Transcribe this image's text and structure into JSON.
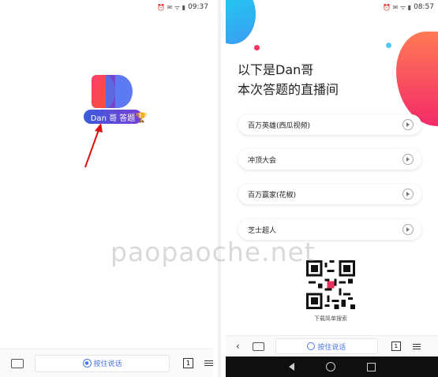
{
  "left": {
    "status_time": "09:37",
    "brand_label": "Dan 哥 答题",
    "bottom": {
      "talk_label": "按住说话",
      "tab_count": "1"
    }
  },
  "right": {
    "status_time": "08:57",
    "headline_line1": "以下是Dan哥",
    "headline_line2": "本次答题的直播间",
    "items": [
      {
        "label": "百万英雄(西瓜视频)"
      },
      {
        "label": "冲顶大会"
      },
      {
        "label": "百万赢家(花椒)"
      },
      {
        "label": "芝士超人"
      }
    ],
    "qr_caption": "下载简单搜索",
    "bottom": {
      "talk_label": "按住说话",
      "tab_count": "1"
    }
  },
  "watermark": "paopaoche.net",
  "colors": {
    "accent_blue": "#4a77e6",
    "brand_red": "#f32a68",
    "brand_cyan": "#1ad4f0"
  }
}
